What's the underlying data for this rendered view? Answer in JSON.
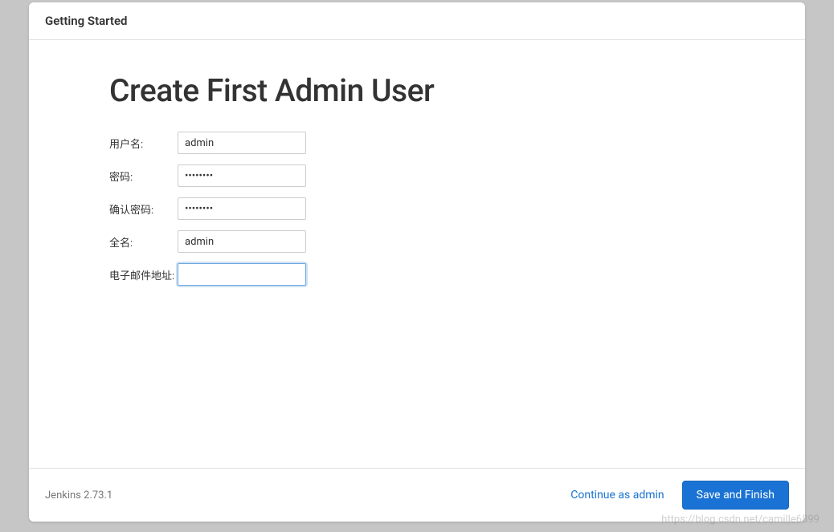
{
  "header": {
    "title": "Getting Started"
  },
  "main": {
    "title": "Create First Admin User",
    "fields": {
      "username": {
        "label": "用户名:",
        "value": "admin"
      },
      "password": {
        "label": "密码:",
        "value": "••••••••"
      },
      "confirm_password": {
        "label": "确认密码:",
        "value": "••••••••"
      },
      "fullname": {
        "label": "全名:",
        "value": "admin"
      },
      "email": {
        "label": "电子邮件地址:",
        "value": ""
      }
    }
  },
  "footer": {
    "version": "Jenkins 2.73.1",
    "continue_label": "Continue as admin",
    "save_label": "Save and Finish"
  },
  "watermark": "https://blog.csdn.net/camille6899"
}
